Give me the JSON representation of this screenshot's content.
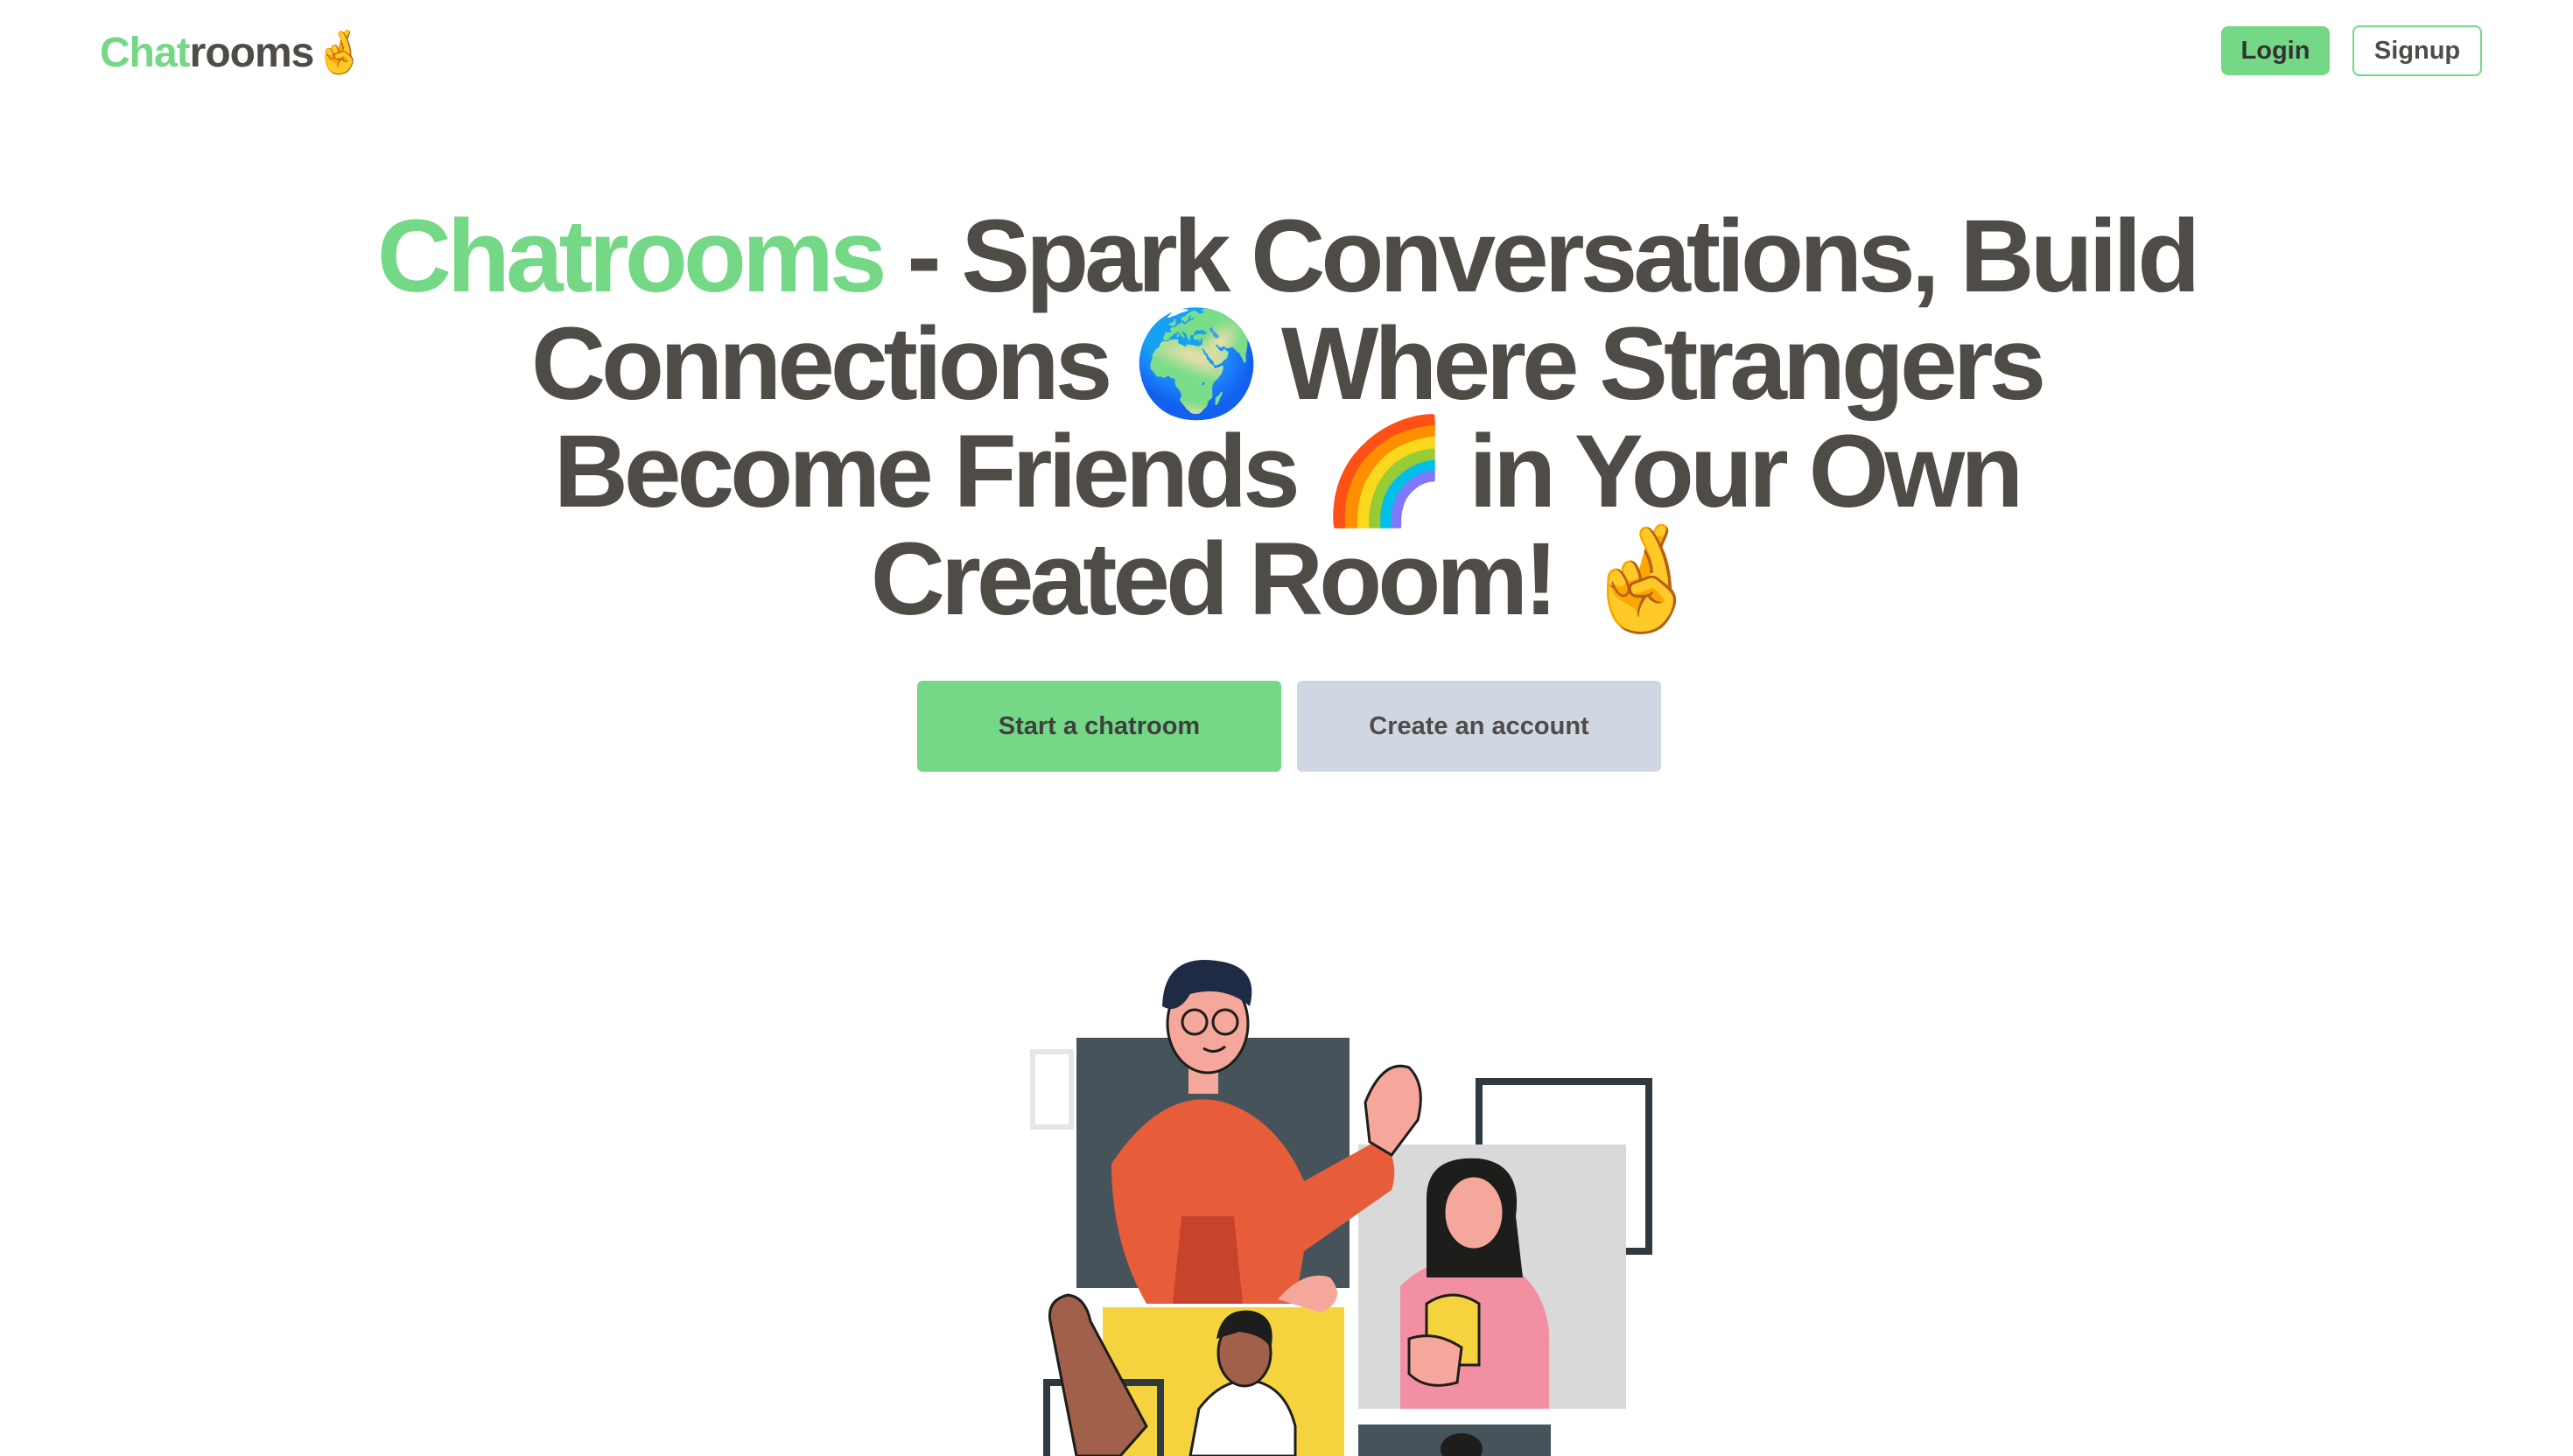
{
  "navbar": {
    "logo_accent": "Chat",
    "logo_rest": "rooms",
    "logo_emoji": "🤞",
    "login_label": "Login",
    "signup_label": "Signup"
  },
  "hero": {
    "title_accent": "Chatrooms",
    "title_part1": " - Spark Conversations, Build Connections ",
    "globe_emoji": "🌍",
    "title_part2": " Where Strangers Become Friends ",
    "rainbow_emoji": "🌈",
    "title_part3": " in Your Own Created Room! ",
    "fingers_emoji": "🤞"
  },
  "cta": {
    "start_label": "Start a chatroom",
    "create_label": "Create an account"
  },
  "colors": {
    "accent": "#75d886",
    "text": "#4f4c48",
    "secondary_button": "#d0d6e2"
  },
  "illustration": {
    "description_icon": "video-call-people-illustration"
  }
}
